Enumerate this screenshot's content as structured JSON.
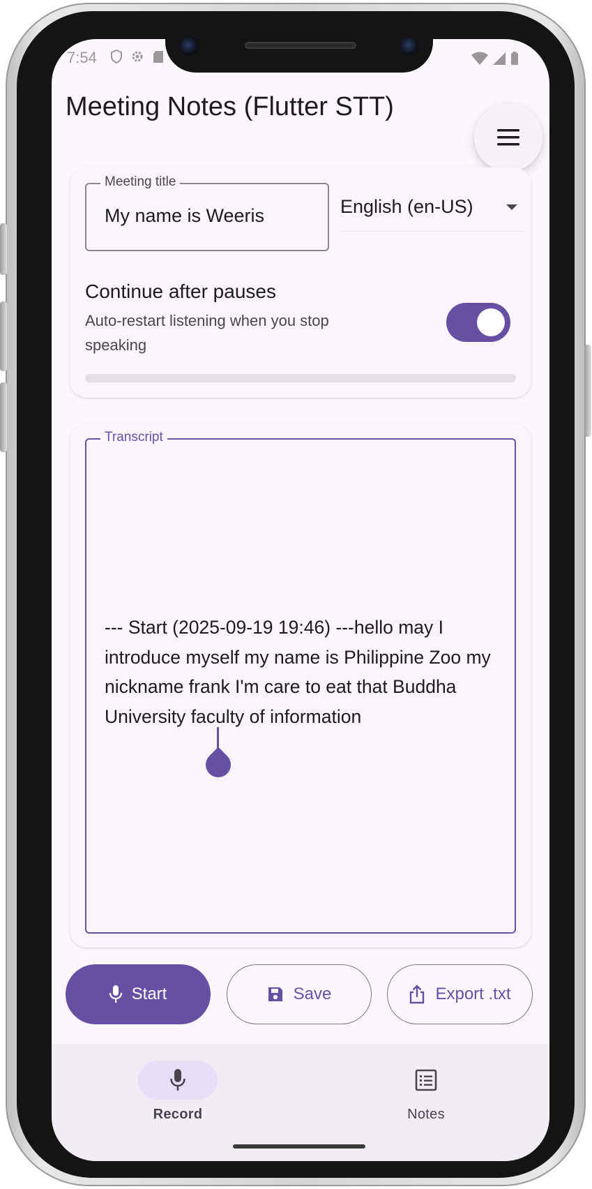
{
  "status_bar": {
    "time": "7:54"
  },
  "app_bar": {
    "title": "Meeting Notes (Flutter STT)"
  },
  "settings": {
    "title_label": "Meeting title",
    "title_value": "My name is Weeris",
    "language": "English (en-US)",
    "continue_label": "Continue after pauses",
    "continue_sub": "Auto-restart listening when you stop speaking",
    "continue_enabled": true,
    "progress": 0
  },
  "transcript": {
    "label": "Transcript",
    "text": "--- Start (2025-09-19 19:46) ---hello may I introduce myself my name is Philippine Zoo my nickname frank I'm care to eat that Buddha University faculty of information"
  },
  "actions": {
    "start": "Start",
    "save": "Save",
    "export": "Export .txt"
  },
  "nav": {
    "record": "Record",
    "notes": "Notes",
    "active": "record"
  },
  "colors": {
    "primary": "#6750a4",
    "surface": "#fcf6fd",
    "nav_indicator": "#e8def8"
  },
  "icons": {
    "menu": "menu-icon",
    "mic": "mic-icon",
    "save": "save-icon",
    "export": "share-icon",
    "notes": "list-icon"
  }
}
